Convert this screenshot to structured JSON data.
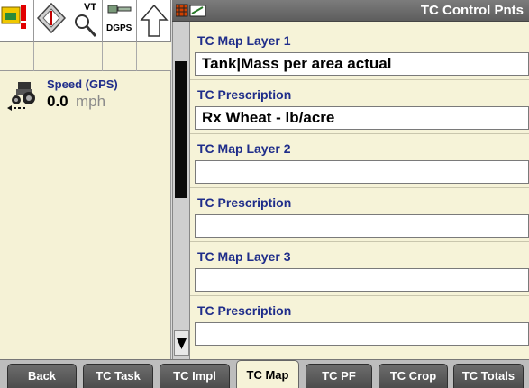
{
  "header": {
    "title": "TC Control Pnts",
    "header_icons": [
      "grid-icon",
      "calculator-icon"
    ]
  },
  "status_icons": [
    {
      "name": "alarm-icon",
      "text": ""
    },
    {
      "name": "compass-icon",
      "text": ""
    },
    {
      "name": "vt-icon",
      "text": "VT"
    },
    {
      "name": "dgps-icon",
      "text": "DGPS"
    },
    {
      "name": "arrow-up-icon",
      "text": ""
    }
  ],
  "speed": {
    "label": "Speed (GPS)",
    "value": "0.0",
    "unit": "mph"
  },
  "fields": [
    {
      "label": "TC Map Layer 1",
      "value": "Tank|Mass per area actual"
    },
    {
      "label": "TC Prescription",
      "value": "Rx Wheat - lb/acre"
    },
    {
      "label": "TC Map Layer 2",
      "value": ""
    },
    {
      "label": "TC Prescription",
      "value": ""
    },
    {
      "label": "TC Map Layer 3",
      "value": ""
    },
    {
      "label": "TC Prescription",
      "value": ""
    }
  ],
  "tabs": [
    {
      "label": "Back",
      "active": false
    },
    {
      "label": "TC Task",
      "active": false
    },
    {
      "label": "TC Impl",
      "active": false
    },
    {
      "label": "TC Map",
      "active": true
    },
    {
      "label": "TC PF",
      "active": false
    },
    {
      "label": "TC Crop",
      "active": false
    },
    {
      "label": "TC Totals",
      "active": false
    }
  ],
  "colors": {
    "label_blue": "#1f2d8a",
    "panel_cream": "#f6f3d8",
    "tab_gray": "#5a5a5a",
    "header_gray": "#6c6c6c"
  }
}
